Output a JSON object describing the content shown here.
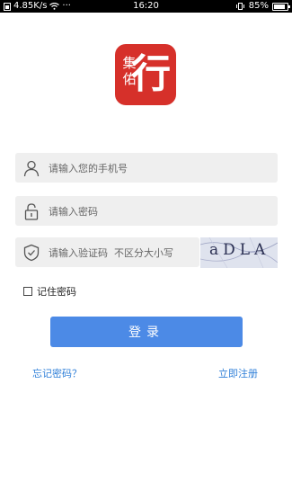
{
  "status_bar": {
    "network_speed": "4.85K/s",
    "time": "16:20",
    "battery": "85%",
    "battery_level": 0.85,
    "icons": [
      "sim-icon",
      "wifi-icon",
      "more-icon",
      "vibrate-icon",
      "battery-icon"
    ]
  },
  "logo": {
    "left_text_top": "集",
    "left_text_bottom": "佑",
    "right_text": "行",
    "color": "#d6302a"
  },
  "form": {
    "phone_placeholder": "请输入您的手机号",
    "password_placeholder": "请输入密码",
    "captcha_placeholder": "请输入验证码  不区分大小写",
    "captcha_text": "aDLA",
    "remember_label": "记住密码",
    "login_label": "登录",
    "forgot_label": "忘记密码？",
    "register_label": "立即注册"
  },
  "colors": {
    "primary": "#4c8ae6",
    "link": "#2f7fd8",
    "field_bg": "#efefef"
  }
}
